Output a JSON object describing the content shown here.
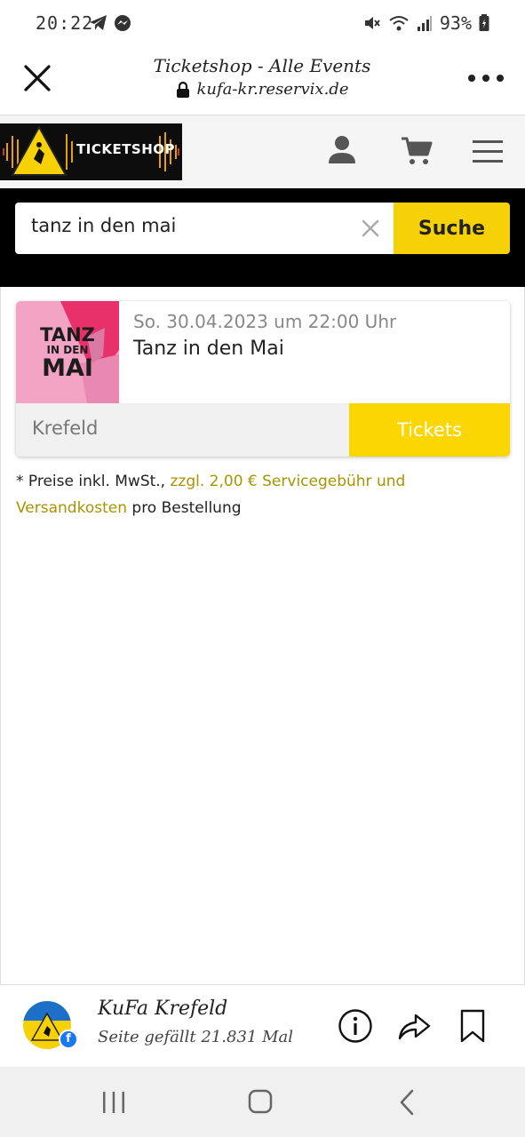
{
  "status_bar": {
    "time": "20:22",
    "battery": "93%",
    "left_icons": [
      "telegram-icon",
      "messenger-icon"
    ],
    "right_icons": [
      "mute-icon",
      "wifi-icon",
      "signal-icon",
      "battery-icon"
    ]
  },
  "browser": {
    "title": "Ticketshop - Alle Events",
    "url": "kufa-kr.reservix.de"
  },
  "site_header": {
    "logo_text": "TICKETSHOP"
  },
  "search": {
    "query": "tanz in den mai",
    "button_label": "Suche"
  },
  "event": {
    "image_lines": [
      "TANZ",
      "IN DEN",
      "MAI"
    ],
    "date": "So. 30.04.2023 um 22:00 Uhr",
    "title": "Tanz in den Mai",
    "location": "Krefeld",
    "tickets_label": "Tickets"
  },
  "price_note": {
    "prefix": "* Preise inkl. MwSt., ",
    "link_text": "zzgl. 2,00 € Servicegebühr und Versandkosten",
    "suffix": " pro Bestellung"
  },
  "facebook_bar": {
    "page_name": "KuFa Krefeld",
    "likes": "Seite gefällt 21.831 Mal",
    "badge": "f"
  },
  "colors": {
    "accent_yellow": "#f7d108",
    "link_gold": "#a89400",
    "event_image_pink": "#f3a4c4"
  }
}
